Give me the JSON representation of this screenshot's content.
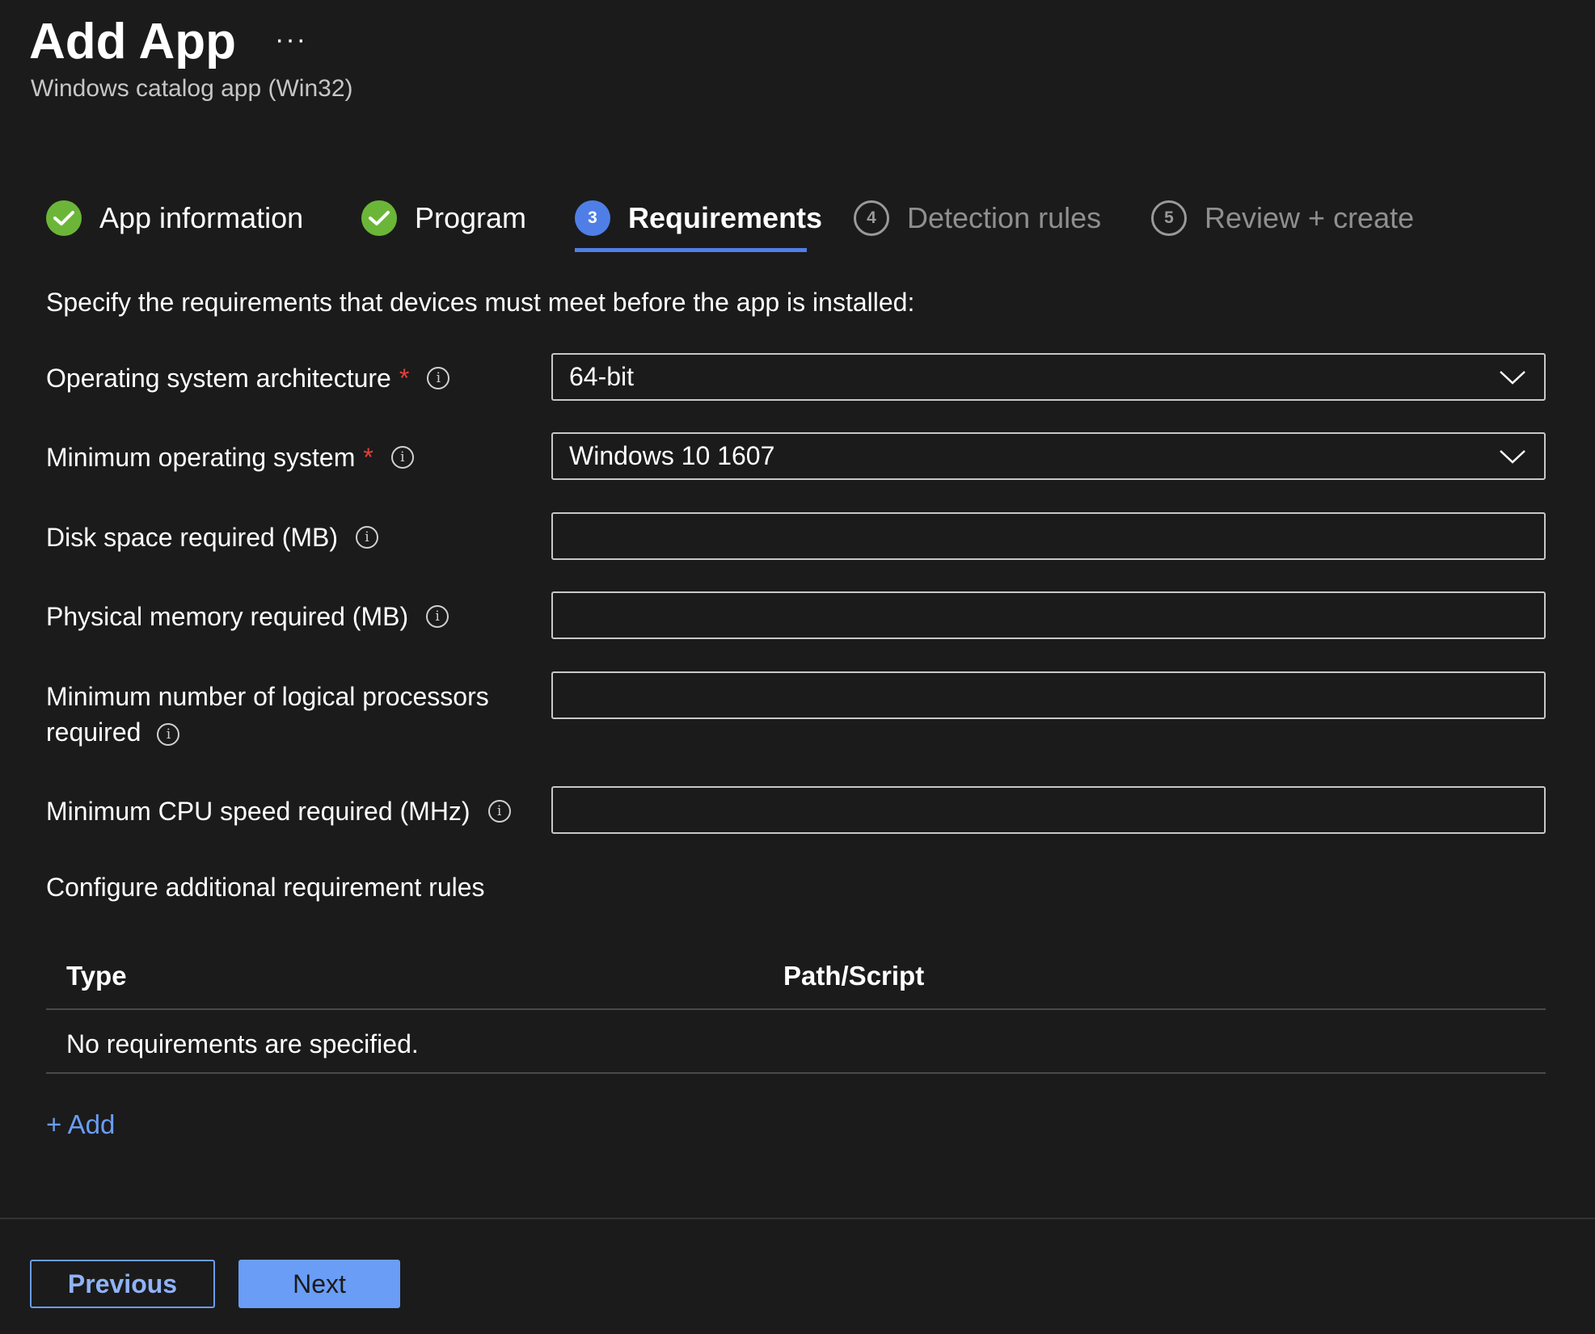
{
  "header": {
    "title": "Add App",
    "more_label": "···",
    "subtitle": "Windows catalog app (Win32)"
  },
  "steps": [
    {
      "label": "App information",
      "state": "done",
      "number": ""
    },
    {
      "label": "Program",
      "state": "done",
      "number": ""
    },
    {
      "label": "Requirements",
      "state": "current",
      "number": "3"
    },
    {
      "label": "Detection rules",
      "state": "pending",
      "number": "4"
    },
    {
      "label": "Review + create",
      "state": "pending",
      "number": "5"
    }
  ],
  "form": {
    "intro": "Specify the requirements that devices must meet before the app is installed:",
    "required_marker": "*",
    "info_glyph": "i",
    "fields": [
      {
        "label": "Operating system architecture",
        "required": true,
        "type": "select",
        "value": "64-bit"
      },
      {
        "label": "Minimum operating system",
        "required": true,
        "type": "select",
        "value": "Windows 10 1607"
      },
      {
        "label": "Disk space required (MB)",
        "required": false,
        "type": "text",
        "value": ""
      },
      {
        "label": "Physical memory required (MB)",
        "required": false,
        "type": "text",
        "value": ""
      },
      {
        "label_line1": "Minimum number of logical processors",
        "label_line2": "required",
        "required": false,
        "type": "text",
        "value": ""
      },
      {
        "label": "Minimum CPU speed required (MHz)",
        "required": false,
        "type": "text",
        "value": ""
      }
    ]
  },
  "rules": {
    "section_label": "Configure additional requirement rules",
    "columns": [
      "Type",
      "Path/Script"
    ],
    "empty_message": "No requirements are specified.",
    "add_label": "+ Add"
  },
  "footer": {
    "previous_label": "Previous",
    "next_label": "Next"
  },
  "colors": {
    "background": "#1b1b1b",
    "accent": "#4f7fe6",
    "link": "#6a9df5",
    "success": "#6bb638",
    "required": "#e5403c"
  },
  "icons": {
    "done": "checkmark-icon",
    "select": "chevron-down-icon",
    "info": "info-icon"
  }
}
